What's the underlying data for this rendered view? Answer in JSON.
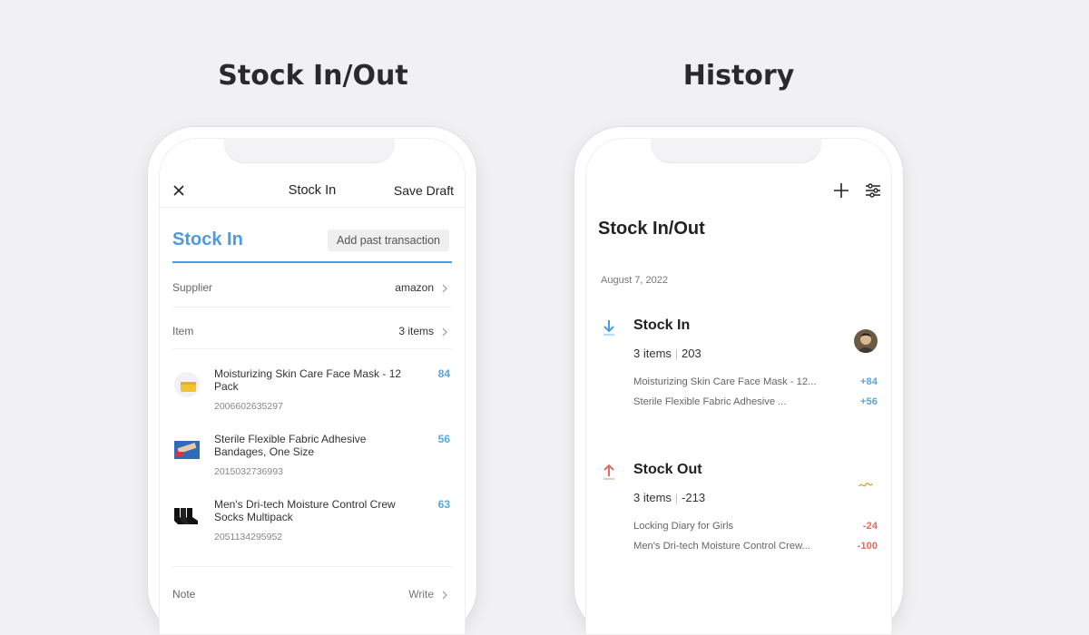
{
  "section_titles": {
    "left": "Stock In/Out",
    "right": "History"
  },
  "left_screen": {
    "topbar": {
      "title": "Stock In",
      "save_label": "Save Draft"
    },
    "tab": {
      "title": "Stock In",
      "past_button": "Add past transaction"
    },
    "supplier": {
      "label": "Supplier",
      "value": "amazon"
    },
    "item_row": {
      "label": "Item",
      "value": "3 items"
    },
    "items": [
      {
        "name": "Moisturizing Skin Care Face Mask - 12 Pack",
        "code": "2006602635297",
        "qty": "84",
        "icon": "face-mask-thumb"
      },
      {
        "name": "Sterile Flexible Fabric Adhesive Bandages, One Size",
        "code": "2015032736993",
        "qty": "56",
        "icon": "bandage-box-thumb"
      },
      {
        "name": "Men's Dri-tech Moisture Control Crew Socks Multipack",
        "code": "2051134295952",
        "qty": "63",
        "icon": "socks-thumb"
      }
    ],
    "note": {
      "label": "Note",
      "value": "Write"
    },
    "accent_color": "#4a9be3"
  },
  "right_screen": {
    "page_title": "Stock In/Out",
    "date": "August 7, 2022",
    "stock_in": {
      "title": "Stock In",
      "count": "3 items",
      "total": "203",
      "lines": [
        {
          "name": "Moisturizing Skin Care Face Mask - 12...",
          "qty": "+84"
        },
        {
          "name": "Sterile Flexible Fabric Adhesive ...",
          "qty": "+56"
        }
      ]
    },
    "stock_out": {
      "title": "Stock Out",
      "count": "3 items",
      "total": "-213",
      "lines": [
        {
          "name": "Locking Diary for Girls",
          "qty": "-24"
        },
        {
          "name": "Men's Dri-tech Moisture Control Crew...",
          "qty": "-100"
        }
      ]
    },
    "in_color": "#5aa7d9",
    "out_color": "#e36b5e"
  }
}
